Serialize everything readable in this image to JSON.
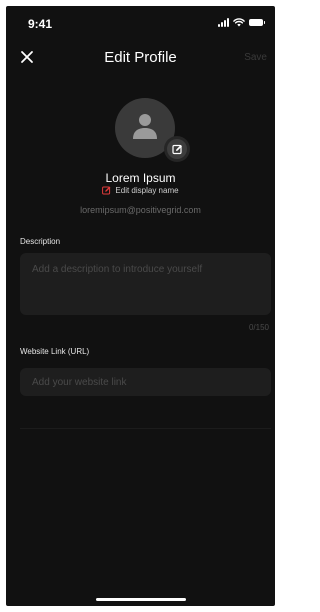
{
  "status_bar": {
    "time": "9:41"
  },
  "nav": {
    "title": "Edit Profile",
    "save_label": "Save"
  },
  "profile": {
    "name": "Lorem Ipsum",
    "edit_name_label": "Edit display name",
    "email": "loremipsum@positivegrid.com"
  },
  "description": {
    "label": "Description",
    "placeholder": "Add a description to introduce yourself",
    "char_count": "0/150"
  },
  "website": {
    "label": "Website Link (URL)",
    "placeholder": "Add your website link"
  },
  "colors": {
    "background": "#111111",
    "accent_red": "#e23b3b",
    "input_bg": "#1e1e1e"
  }
}
